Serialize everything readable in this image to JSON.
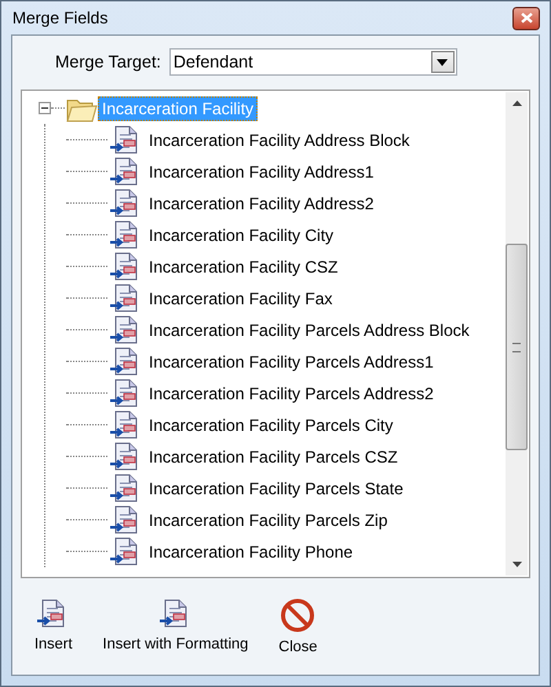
{
  "window": {
    "title": "Merge Fields"
  },
  "merge_target": {
    "label": "Merge Target:",
    "value": "Defendant"
  },
  "tree": [
    {
      "label": "Incarceration Facility",
      "expanded": true,
      "selected": true,
      "children": [
        {
          "label": "Incarceration Facility Address Block",
          "selected": false
        },
        {
          "label": "Incarceration Facility Address1",
          "selected": false
        },
        {
          "label": "Incarceration Facility Address2",
          "selected": false
        },
        {
          "label": "Incarceration Facility City",
          "selected": false
        },
        {
          "label": "Incarceration Facility CSZ",
          "selected": false
        },
        {
          "label": "Incarceration Facility Fax",
          "selected": false
        },
        {
          "label": "Incarceration Facility Parcels Address Block",
          "selected": false
        },
        {
          "label": "Incarceration Facility Parcels Address1",
          "selected": false
        },
        {
          "label": "Incarceration Facility Parcels Address2",
          "selected": false
        },
        {
          "label": "Incarceration Facility Parcels City",
          "selected": false
        },
        {
          "label": "Incarceration Facility Parcels CSZ",
          "selected": false
        },
        {
          "label": "Incarceration Facility Parcels State",
          "selected": false
        },
        {
          "label": "Incarceration Facility Parcels Zip",
          "selected": false
        },
        {
          "label": "Incarceration Facility Phone",
          "selected": false
        }
      ]
    }
  ],
  "buttons": [
    {
      "label": "Insert",
      "kind": "insert"
    },
    {
      "label": "Insert with Formatting",
      "kind": "insert"
    },
    {
      "label": "Close",
      "kind": "close"
    }
  ]
}
